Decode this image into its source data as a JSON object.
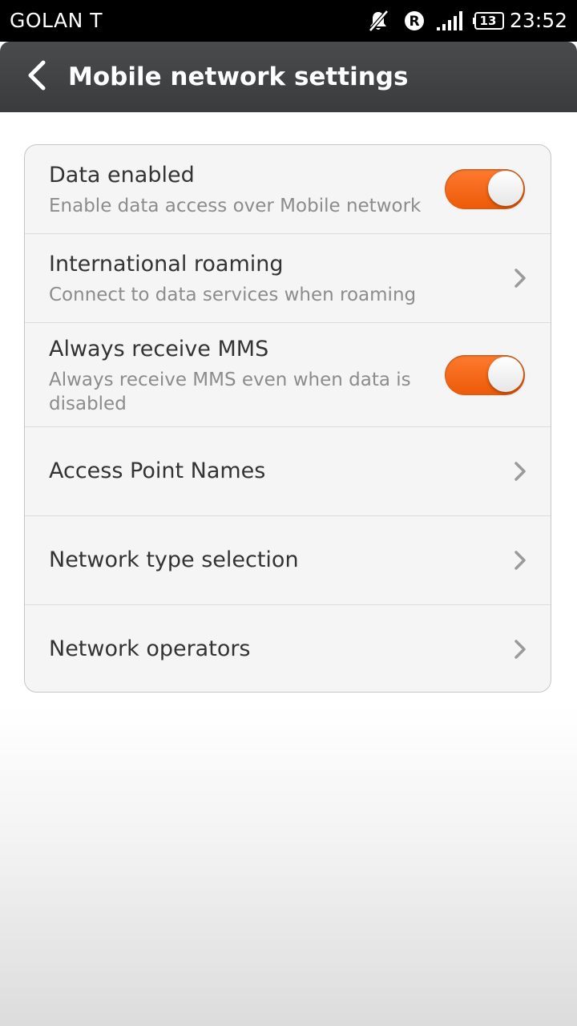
{
  "status_bar": {
    "carrier": "GOLAN T",
    "icons": [
      "notifications-muted-icon",
      "roaming-r-icon",
      "signal-strength-icon",
      "battery-icon"
    ],
    "battery_level": "13",
    "time": "23:52"
  },
  "header": {
    "back_icon": "chevron-left-icon",
    "title": "Mobile network settings"
  },
  "settings": [
    {
      "title": "Data enabled",
      "summary": "Enable data access over Mobile network",
      "control": "toggle",
      "checked": true
    },
    {
      "title": "International roaming",
      "summary": "Connect to data services when roaming",
      "control": "chevron-right-icon"
    },
    {
      "title": "Always receive MMS",
      "summary": "Always receive MMS even when data is disabled",
      "control": "toggle",
      "checked": true
    },
    {
      "title": "Access Point Names",
      "control": "chevron-right-icon"
    },
    {
      "title": "Network type selection",
      "control": "chevron-right-icon"
    },
    {
      "title": "Network operators",
      "control": "chevron-right-icon"
    }
  ],
  "colors": {
    "status_bar": "#000000",
    "action_bar": "#414244",
    "toggle_on": "#f26418",
    "card_background": "#f5f5f5",
    "title_text": "#333333",
    "summary_text": "#8c8c8c"
  }
}
